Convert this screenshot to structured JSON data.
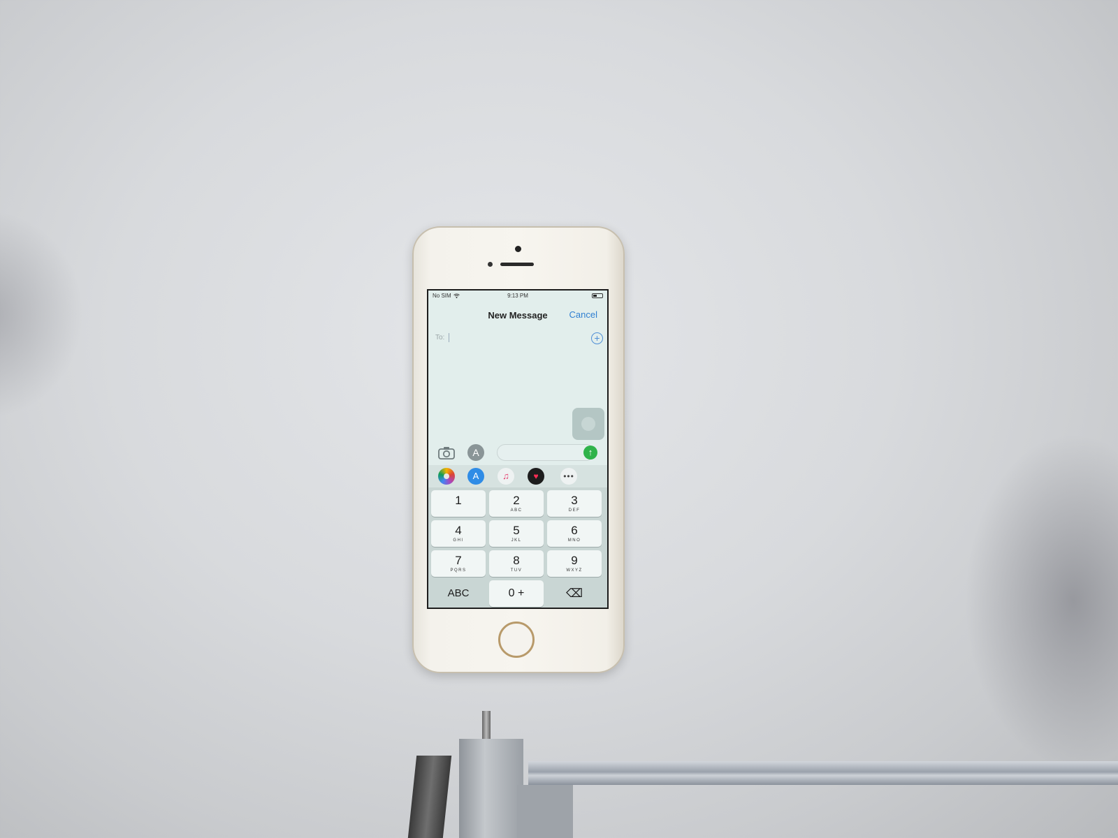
{
  "status_bar": {
    "carrier": "No SIM",
    "time": "9:13 PM"
  },
  "nav": {
    "title": "New Message",
    "cancel_label": "Cancel"
  },
  "recipient": {
    "label": "To:",
    "add_symbol": "+"
  },
  "compose": {
    "send_symbol": "↑",
    "appstore_symbol": "A"
  },
  "apps": {
    "store_symbol": "A",
    "music_symbol": "♫",
    "heart_symbol": "♥",
    "more_symbol": "•••"
  },
  "keypad": {
    "keys": [
      {
        "num": "1",
        "letters": ""
      },
      {
        "num": "2",
        "letters": "ABC"
      },
      {
        "num": "3",
        "letters": "DEF"
      },
      {
        "num": "4",
        "letters": "GHI"
      },
      {
        "num": "5",
        "letters": "JKL"
      },
      {
        "num": "6",
        "letters": "MNO"
      },
      {
        "num": "7",
        "letters": "PQRS"
      },
      {
        "num": "8",
        "letters": "TUV"
      },
      {
        "num": "9",
        "letters": "WXYZ"
      }
    ],
    "abc_label": "ABC",
    "zero_label": "0 +",
    "delete_symbol": "⌫"
  },
  "colors": {
    "accent": "#2f7fd1",
    "send": "#2fb34a"
  }
}
